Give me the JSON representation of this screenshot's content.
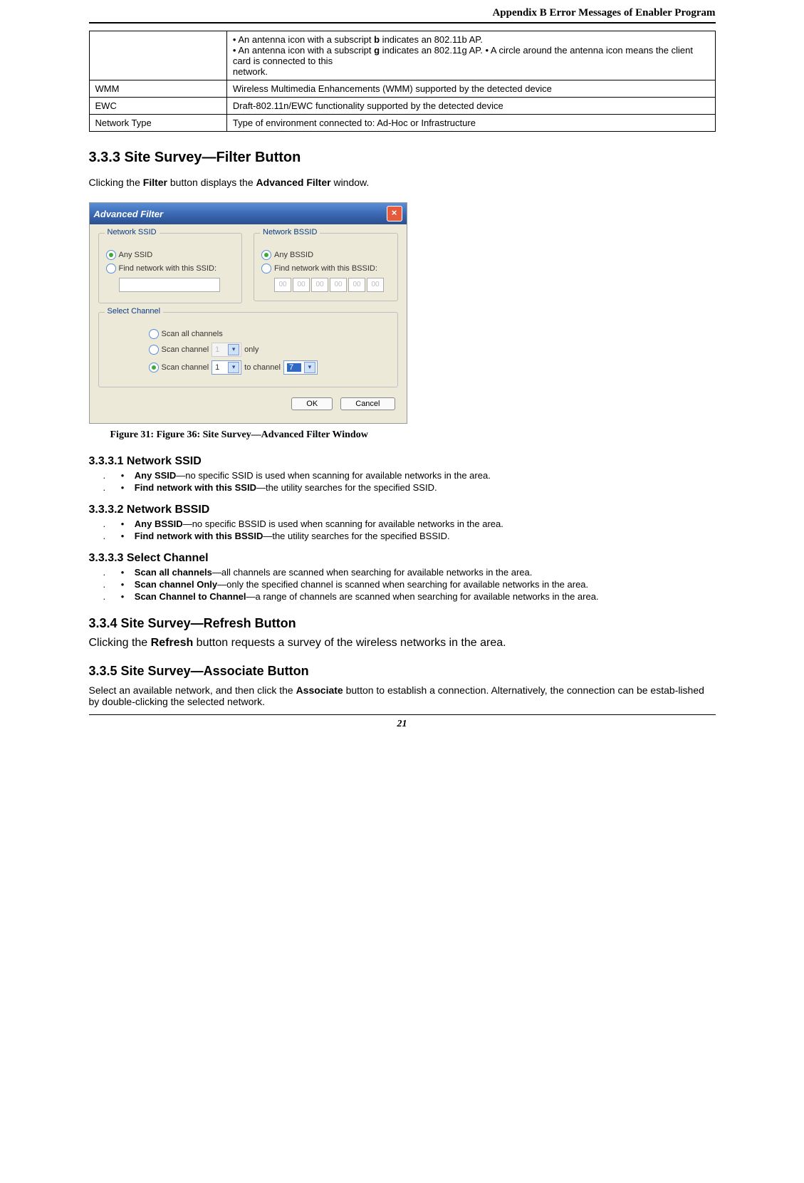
{
  "header": {
    "title": "Appendix B Error Messages of Enabler Program"
  },
  "table1": {
    "row0_desc_before_b": "• An antenna icon with a subscript ",
    "row0_b": "b",
    "row0_desc_after_b": " indicates an 802.11b AP.",
    "row0_desc2_before_g": "• An antenna icon with a subscript ",
    "row0_g": "g",
    "row0_desc2_after_g": " indicates an 802.11g AP. • A circle around the antenna icon means the client card is connected to this",
    "row0_desc3": "network.",
    "wmm_label": "WMM",
    "wmm_desc": "Wireless Multimedia Enhancements (WMM) supported by the detected device",
    "ewc_label": "EWC",
    "ewc_desc": "Draft-802.11n/EWC functionality supported by the detected device",
    "nt_label": "Network Type",
    "nt_desc": "Type of environment connected to: Ad-Hoc or Infrastructure"
  },
  "h333": "3.3.3 Site Survey—Filter Button",
  "p333_before": "Clicking the ",
  "p333_b1": "Filter",
  "p333_mid": " button displays the ",
  "p333_b2": "Advanced Filter",
  "p333_after": " window.",
  "afw": {
    "title": "Advanced Filter",
    "ssid_label": "Network SSID",
    "any_ssid": "Any SSID",
    "find_ssid": "Find network with this SSID:",
    "bssid_label": "Network BSSID",
    "any_bssid": "Any BSSID",
    "find_bssid": "Find network with this BSSID:",
    "bssid_seg": "00",
    "chan_label": "Select Channel",
    "scan_all": "Scan all channels",
    "scan_one_pre": "Scan channel",
    "scan_one_val": "1",
    "scan_one_post": "only",
    "scan_range_pre": "Scan channel",
    "scan_range_v1": "1",
    "scan_range_mid": "to channel",
    "scan_range_v2": "7",
    "ok": "OK",
    "cancel": "Cancel"
  },
  "caption": "Figure 31: Figure 36: Site Survey—Advanced Filter Window",
  "s3331": {
    "h": "3.3.3.1 Network SSID",
    "i1_b": "Any SSID",
    "i1_t": "—no specific SSID is used when scanning for available networks in the area.",
    "i2_b": "Find network with this SSID",
    "i2_t": "—the utility searches for the specified SSID."
  },
  "s3332": {
    "h": "3.3.3.2 Network BSSID",
    "i1_b": "Any BSSID",
    "i1_t": "—no specific BSSID is used when scanning for available networks in the area.",
    "i2_b": "Find network with this BSSID",
    "i2_t": "—the utility searches for the specified BSSID."
  },
  "s3333": {
    "h": "3.3.3.3 Select Channel",
    "i1_b": "Scan all channels",
    "i1_t": "—all channels are scanned when searching for available networks in the area.",
    "i2_b": "Scan channel Only",
    "i2_t": "—only the specified channel is scanned when searching for available networks in the area.",
    "i3_b": "Scan Channel to Channel",
    "i3_t": "—a range of channels are scanned when searching for available networks in the area."
  },
  "s334": {
    "h": "3.3.4 Site Survey—Refresh Button",
    "p_before": "Clicking the ",
    "p_b": "Refresh",
    "p_after": " button requests a survey of the wireless networks in the area."
  },
  "s335": {
    "h": "3.3.5 Site Survey—Associate Button",
    "p_before": "Select an available network, and then click the ",
    "p_b": "Associate",
    "p_after": " button to establish a connection. Alternatively, the connection can be estab-lished by double-clicking the selected network."
  },
  "footer": "21"
}
